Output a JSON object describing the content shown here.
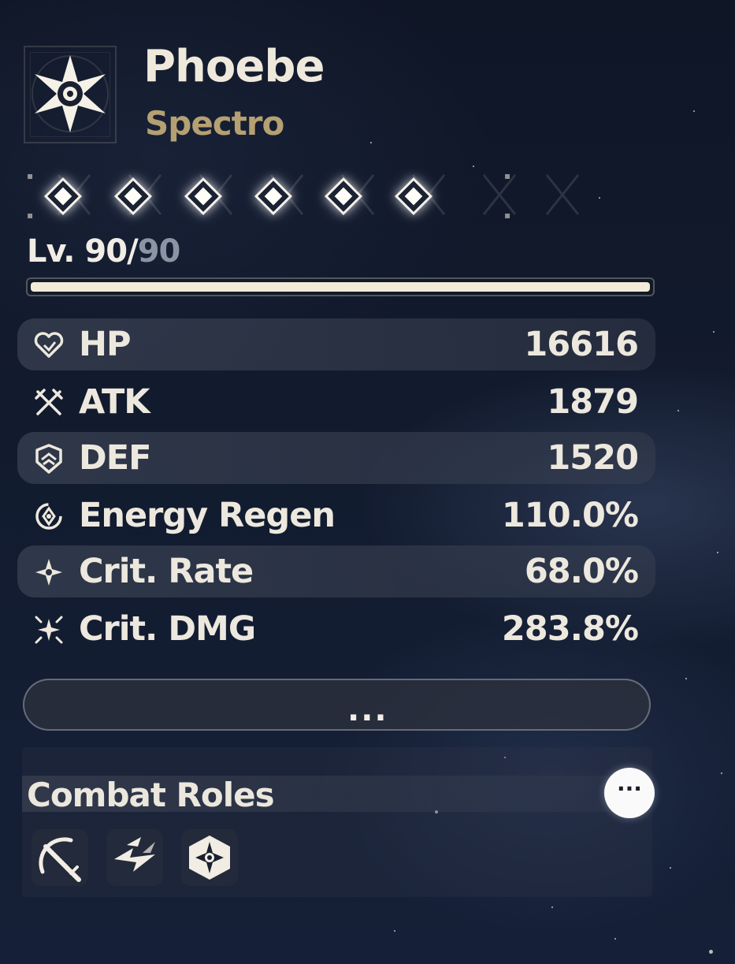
{
  "character": {
    "name": "Phoebe",
    "element": "Spectro",
    "element_icon": "spectro-emblem-icon"
  },
  "sequence": {
    "nodes_unlocked": 6,
    "nodes_total": 6
  },
  "level": {
    "label_prefix": "Lv. ",
    "current": "90",
    "separator": "/",
    "max": "90",
    "progress": 1.0
  },
  "stats": [
    {
      "icon": "hp-heart-icon",
      "label": "HP",
      "value": "16616",
      "shaded": true
    },
    {
      "icon": "atk-crossed-swords-icon",
      "label": "ATK",
      "value": "1879",
      "shaded": false
    },
    {
      "icon": "def-shield-icon",
      "label": "DEF",
      "value": "1520",
      "shaded": true
    },
    {
      "icon": "energy-regen-icon",
      "label": "Energy Regen",
      "value": "110.0%",
      "shaded": false
    },
    {
      "icon": "crit-rate-star-icon",
      "label": "Crit. Rate",
      "value": "68.0%",
      "shaded": true
    },
    {
      "icon": "crit-dmg-burst-icon",
      "label": "Crit. DMG",
      "value": "283.8%",
      "shaded": false
    }
  ],
  "more_button": {
    "label": "..."
  },
  "combat_roles": {
    "title": "Combat Roles",
    "info_label": "···",
    "roles": [
      {
        "icon": "slash-sword-role-icon"
      },
      {
        "icon": "lightning-burst-role-icon"
      },
      {
        "icon": "spectro-hex-role-icon"
      }
    ]
  },
  "colors": {
    "accent_gold": "#b5a072",
    "text": "#ece8df",
    "muted": "#8b94a2",
    "background": "#121b2e"
  }
}
